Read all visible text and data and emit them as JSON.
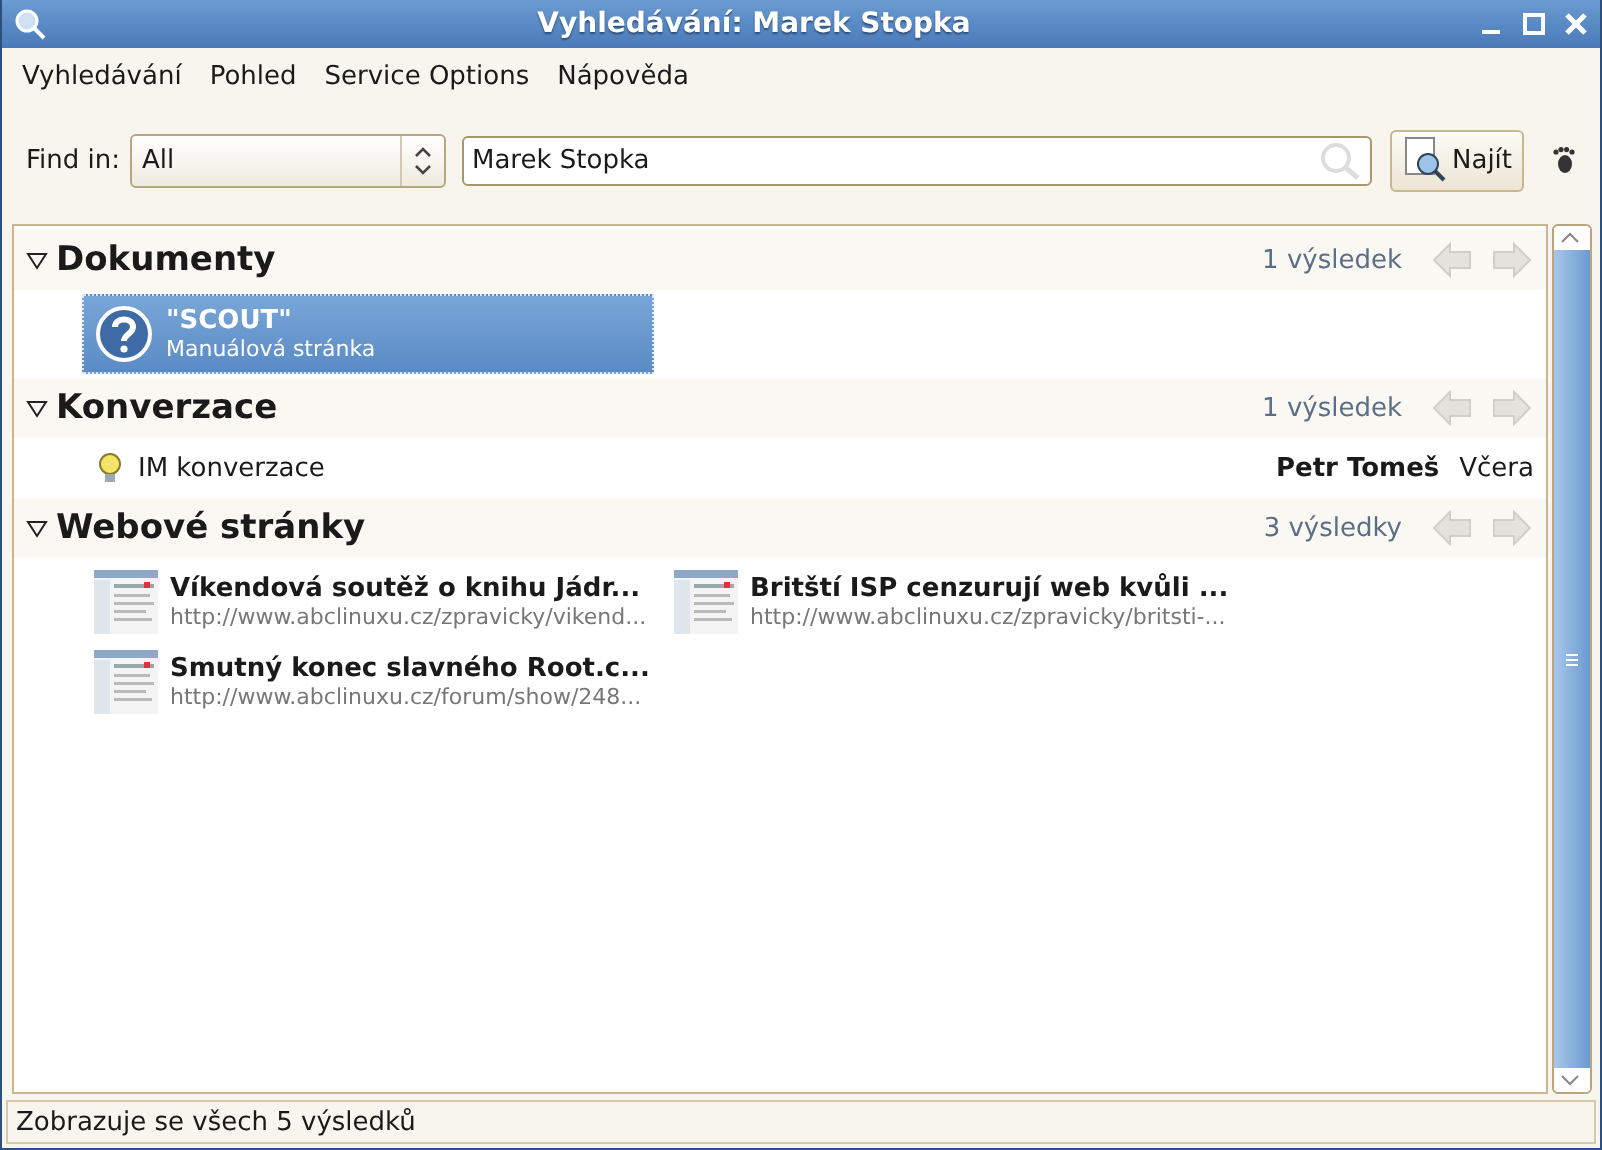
{
  "window": {
    "title": "Vyhledávání: Marek Stopka"
  },
  "menu": [
    {
      "label": "Vyhledávání"
    },
    {
      "label": "Pohled"
    },
    {
      "label": "Service Options"
    },
    {
      "label": "Nápověda"
    }
  ],
  "toolbar": {
    "find_in_label": "Find in:",
    "scope": "All",
    "search_value": "Marek Stopka",
    "search_button": "Najít"
  },
  "categories": [
    {
      "title": "Dokumenty",
      "expanded": true,
      "count": "1 výsledek",
      "items": [
        {
          "kind": "document",
          "title": "\"SCOUT\"",
          "subtitle": "Manuálová stránka",
          "selected": true
        }
      ]
    },
    {
      "title": "Konverzace",
      "expanded": true,
      "count": "1 výsledek",
      "items": [
        {
          "kind": "conversation",
          "title": "IM konverzace",
          "person": "Petr Tomeš",
          "date": "Včera",
          "selected": false
        }
      ]
    },
    {
      "title": "Webové stránky",
      "expanded": true,
      "count": "3 výsledky",
      "items": [
        {
          "kind": "web",
          "title": "Víkendová soutěž o knihu Jádr...",
          "subtitle": "http://www.abclinuxu.cz/zpravicky/vikend...",
          "selected": false
        },
        {
          "kind": "web",
          "title": "Britští ISP cenzurují web kvůli ...",
          "subtitle": "http://www.abclinuxu.cz/zpravicky/britsti-...",
          "selected": false
        },
        {
          "kind": "web",
          "title": "Smutný konec slavného Root.c...",
          "subtitle": "http://www.abclinuxu.cz/forum/show/248...",
          "selected": false
        }
      ]
    }
  ],
  "status_bar": "Zobrazuje se všech 5 výsledků"
}
